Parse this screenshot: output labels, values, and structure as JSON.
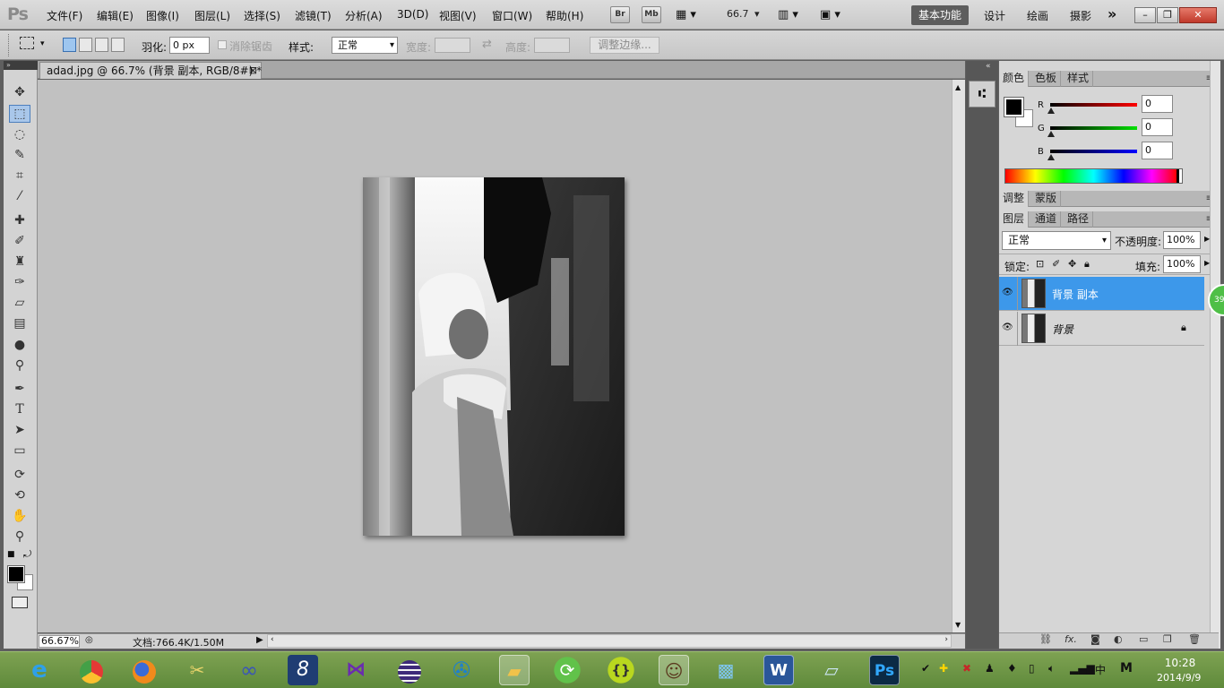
{
  "app": {
    "logo": "Ps"
  },
  "menu": [
    "文件(F)",
    "编辑(E)",
    "图像(I)",
    "图层(L)",
    "选择(S)",
    "滤镜(T)",
    "分析(A)",
    "3D(D)",
    "视图(V)",
    "窗口(W)",
    "帮助(H)"
  ],
  "menubar_buttons": {
    "br": "Br",
    "mb": "Mb",
    "zoom": "66.7"
  },
  "workspaces": {
    "active": "基本功能",
    "items": [
      "设计",
      "绘画",
      "摄影"
    ],
    "more": "»"
  },
  "window_controls": {
    "minimize": "–",
    "restore": "❐",
    "close": "✕"
  },
  "options": {
    "feather_label": "羽化:",
    "feather_value": "0 px",
    "antialias_label": "消除锯齿",
    "style_label": "样式:",
    "style_value": "正常",
    "width_label": "宽度:",
    "height_label": "高度:",
    "refine_edge": "调整边缘..."
  },
  "document": {
    "tab_title": "adad.jpg @ 66.7% (背景 副本, RGB/8#) *",
    "tab_close": "⊠",
    "zoom": "66.67%",
    "doc_info": "文档:766.4K/1.50M"
  },
  "color_panel": {
    "tabs": [
      "颜色",
      "色板",
      "样式"
    ],
    "r_label": "R",
    "g_label": "G",
    "b_label": "B",
    "r_value": "0",
    "g_value": "0",
    "b_value": "0"
  },
  "adjust_panel": {
    "tabs": [
      "调整",
      "蒙版"
    ]
  },
  "layers_panel": {
    "tabs": [
      "图层",
      "通道",
      "路径"
    ],
    "blend_mode": "正常",
    "opacity_label": "不透明度:",
    "opacity_value": "100%",
    "lock_label": "锁定:",
    "fill_label": "填充:",
    "fill_value": "100%",
    "layers": [
      {
        "name": "背景 副本",
        "selected": true
      },
      {
        "name": "背景",
        "selected": false
      }
    ]
  },
  "badge": "39",
  "taskbar": {
    "apps": [
      "ie-icon",
      "chrome-icon",
      "firefox-icon",
      "tools-icon",
      "infinity-icon",
      "app8-icon",
      "visual-studio-icon",
      "eclipse-icon",
      "media-icon",
      "folder-icon",
      "refresh-icon",
      "brackets-icon",
      "avatar-icon",
      "photo-viewer-icon",
      "word-icon",
      "notes-icon",
      "photoshop-icon"
    ],
    "ime": "M",
    "time": "10:28",
    "date": "2014/9/9"
  },
  "colors": {
    "accent": "#3d98ea",
    "selected_layer": "#3d98ea",
    "taskbar": "#6b9444"
  }
}
